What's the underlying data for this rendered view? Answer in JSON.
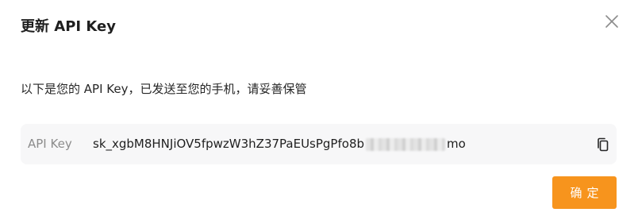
{
  "dialog": {
    "title": "更新 API Key",
    "message": "以下是您的 API Key，已发送至您的手机，请妥善保管",
    "key_label": "API Key",
    "key_value_prefix": "sk_xgbM8HNJiOV5fpwzW3hZ37PaEUsPgPfo8b",
    "key_value_suffix": "mo",
    "confirm_label": "确定",
    "close_icon": "close-icon",
    "copy_icon": "copy-icon",
    "accent_color": "#f7941d"
  }
}
